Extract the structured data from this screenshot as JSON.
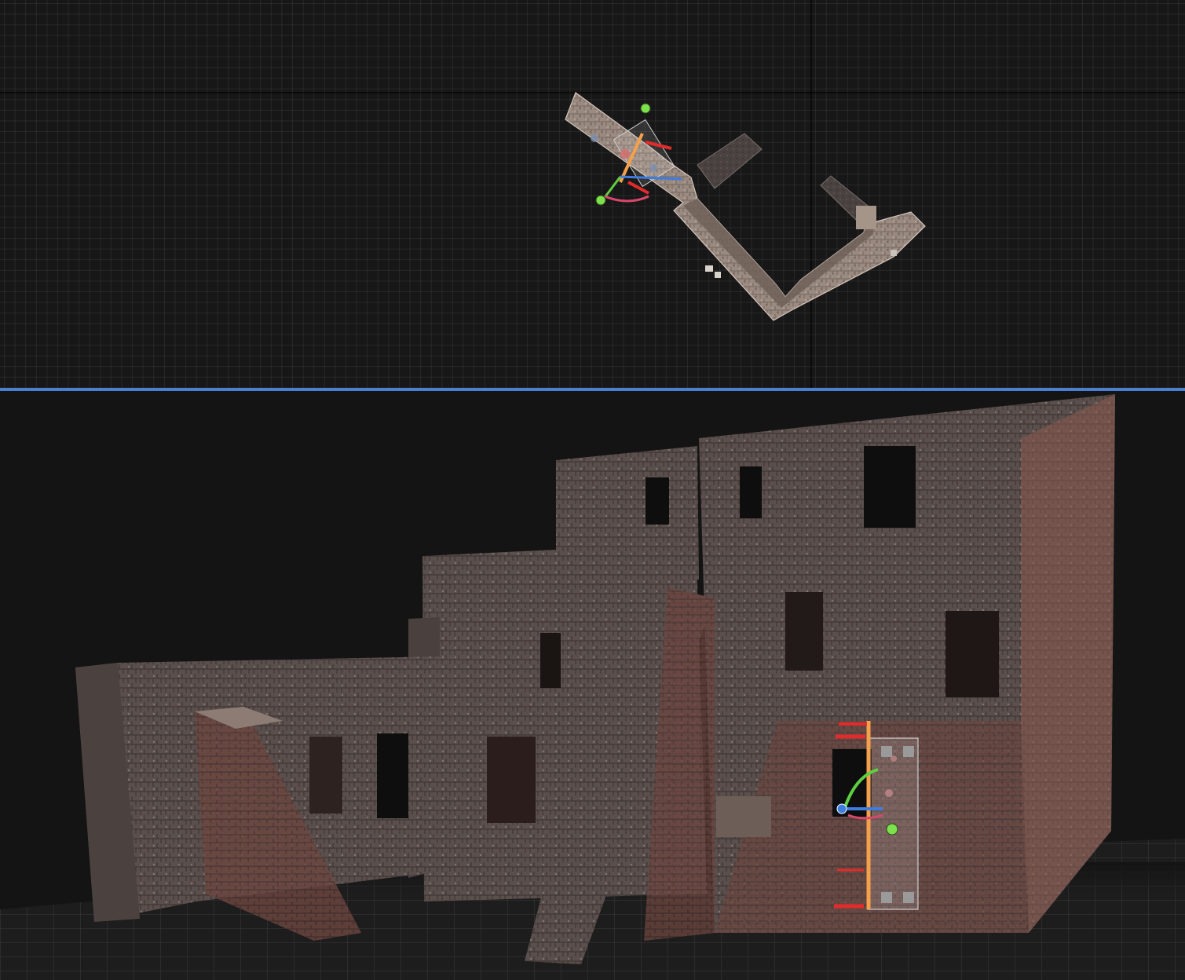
{
  "app": {
    "views": [
      {
        "id": "top",
        "projection": "orthographic-top",
        "grid": true,
        "active": false
      },
      {
        "id": "bottom",
        "projection": "perspective",
        "grid": true,
        "active": true
      }
    ]
  },
  "colors": {
    "viewport_bg": "#171717",
    "grid_line": "#2c2c2c",
    "divider": "#4d7fd0",
    "axis_x": "#e22b2b",
    "axis_y": "#5fcf42",
    "axis_z": "#3d7de0",
    "slice_plane": "#f5a04a",
    "rotate_arc": "#d9476b",
    "handle_dot": "#7ee04b",
    "stone_light": "#a4948a",
    "stone_dark": "#4f4541",
    "brick_red": "#8a4a40"
  },
  "gizmos": [
    {
      "view": "top",
      "icons": [
        "move-x-arrow-icon",
        "move-y-arrow-icon",
        "move-z-arrow-icon",
        "rotate-handle-icon",
        "scale-handle-icon",
        "slice-plane-icon"
      ]
    },
    {
      "view": "bottom",
      "icons": [
        "move-x-arrow-icon",
        "move-y-arrow-icon",
        "move-z-arrow-icon",
        "rotate-handle-icon",
        "scale-handle-icon",
        "slice-plane-icon"
      ]
    }
  ]
}
